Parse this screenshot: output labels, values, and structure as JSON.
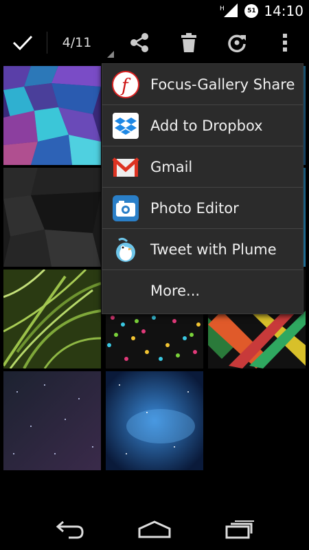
{
  "status_bar": {
    "time": "14:10",
    "network": "H",
    "notification_count": "51"
  },
  "action_bar": {
    "counter": "4/11",
    "icons": [
      "done-check-icon",
      "share-icon",
      "trash-icon",
      "rotate-icon",
      "overflow-menu-icon"
    ]
  },
  "share_menu": {
    "items": [
      {
        "label": "Focus-Gallery Share",
        "icon": "focus-gallery-icon"
      },
      {
        "label": "Add to Dropbox",
        "icon": "dropbox-icon"
      },
      {
        "label": "Gmail",
        "icon": "gmail-icon"
      },
      {
        "label": "Photo Editor",
        "icon": "photo-editor-icon"
      },
      {
        "label": "Tweet with Plume",
        "icon": "plume-icon"
      },
      {
        "label": "More..."
      }
    ]
  },
  "gallery": {
    "thumbnails": [
      "cubes-colorful",
      "dark-cubes",
      "wallpaper-3",
      "green-grass",
      "confetti-pattern",
      "geometric-stripes",
      "night-sky-purple",
      "blue-nebula"
    ]
  },
  "nav_bar": {
    "icons": [
      "back-icon",
      "home-icon",
      "recents-icon"
    ]
  }
}
